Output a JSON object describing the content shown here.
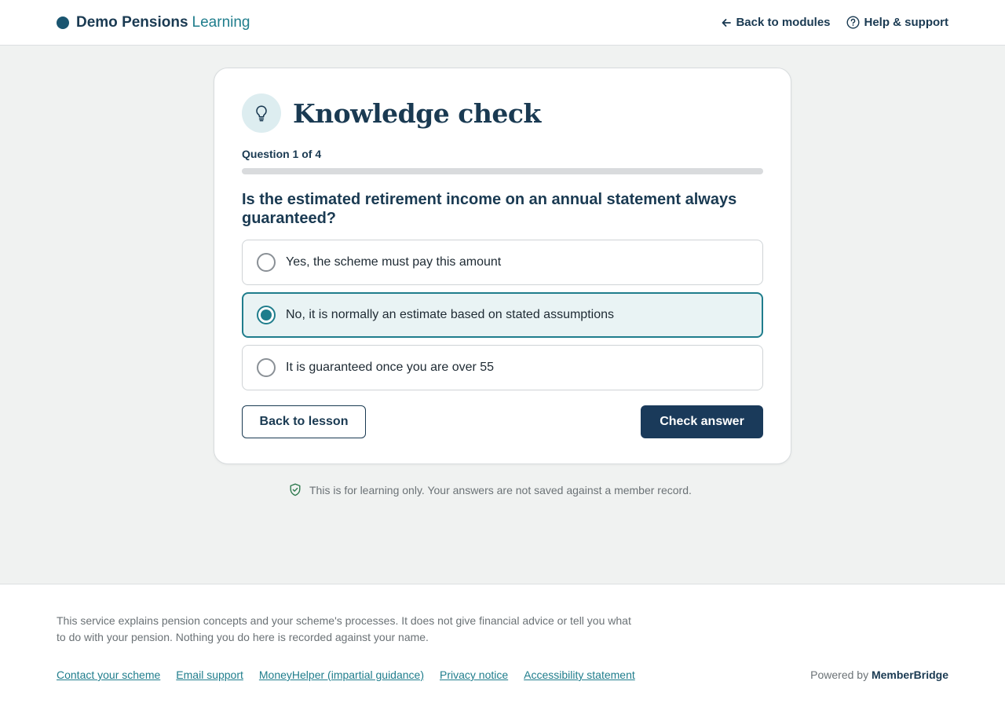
{
  "header": {
    "brand_main": "Demo Pensions",
    "brand_accent": "Learning",
    "back_link": "Back to modules",
    "help_link": "Help & support"
  },
  "quiz": {
    "title": "Knowledge check",
    "icon": "lightbulb-icon",
    "question_count": "Question 1 of 4",
    "progress_fraction": 0,
    "question": "Is the estimated retirement income on an annual statement always guaranteed?",
    "options": [
      {
        "label": "Yes, the scheme must pay this amount",
        "selected": false
      },
      {
        "label": "No, it is normally an estimate based on stated assumptions",
        "selected": true
      },
      {
        "label": "It is guaranteed once you are over 55",
        "selected": false
      }
    ],
    "back_button": "Back to lesson",
    "check_button": "Check answer"
  },
  "notice": "This is for learning only. Your answers are not saved against a member record.",
  "footer": {
    "text": "This service explains pension concepts and your scheme's processes. It does not give financial advice or tell you what to do with your pension. Nothing you do here is recorded against your name.",
    "links": [
      "Contact your scheme",
      "Email support",
      "MoneyHelper (impartial guidance)",
      "Privacy notice",
      "Accessibility statement"
    ],
    "powered_prefix": "Powered by",
    "powered_brand": "MemberBridge"
  },
  "colors": {
    "primary": "#1a3a52",
    "accent": "#1f7d8c",
    "background": "#f0f2f1"
  }
}
